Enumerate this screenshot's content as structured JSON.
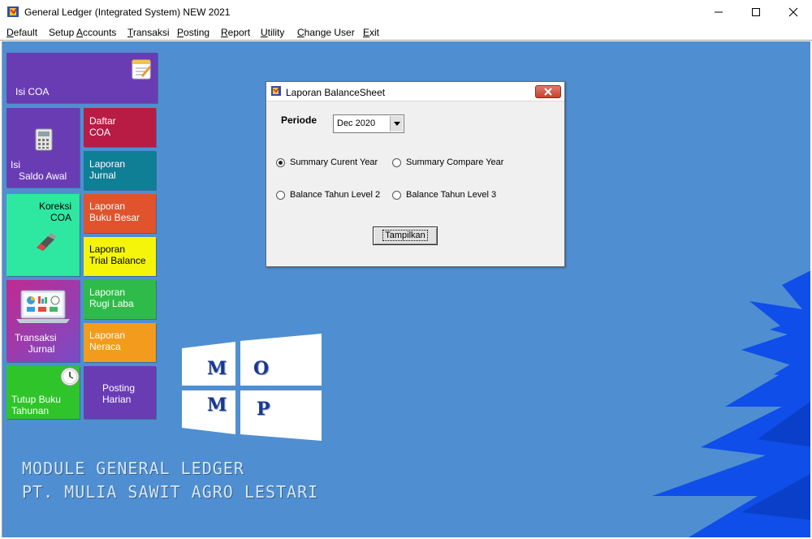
{
  "window": {
    "title": "General Ledger (Integrated System) NEW 2021",
    "app_icon": "app-icon",
    "buttons": [
      "minimize-icon",
      "maximize-icon",
      "close-icon"
    ]
  },
  "menu": {
    "items": [
      {
        "label": "Default",
        "u": "D",
        "rest": "efault"
      },
      {
        "label": "Setup Accounts",
        "pre": "Setup ",
        "u": "A",
        "rest": "ccounts"
      },
      {
        "label": "Transaksi",
        "u": "T",
        "rest": "ransaksi"
      },
      {
        "label": "Posting",
        "u": "P",
        "rest": "osting"
      },
      {
        "label": "Report",
        "u": "R",
        "rest": "eport"
      },
      {
        "label": "Utility",
        "u": "U",
        "rest": "tility"
      },
      {
        "label": "Change User",
        "u": "C",
        "rest": "hange User"
      },
      {
        "label": "Exit",
        "u": "E",
        "rest": "xit"
      }
    ]
  },
  "tiles": {
    "isi_coa": "Isi COA",
    "isi_saldo_awal": "Isi\n   Saldo Awal",
    "daftar_coa": "Daftar\nCOA",
    "laporan_jurnal": "Laporan\nJurnal",
    "koreksi_coa": "Koreksi\nCOA",
    "laporan_buku_besar": "Laporan\nBuku Besar",
    "laporan_trial_balance": "Laporan\nTrial Balance",
    "transaksi_jurnal": "Transaksi\n     Jurnal",
    "laporan_rugi_laba": "Laporan\nRugi Laba",
    "laporan_neraca": "Laporan\nNeraca",
    "tutup_buku_tahunan": "Tutup Buku\nTahunan",
    "posting_harian": "Posting\nHarian"
  },
  "colors": {
    "desktop": "#4f8fd1",
    "purple": "#6a3cb4",
    "crimson": "#b81c44",
    "teal": "#0e7f95",
    "mint": "#2ee8a2",
    "orange_red": "#e0532c",
    "yellow": "#f5f50a",
    "magenta": "#b5338f",
    "green": "#2fbb49",
    "orange": "#f39b1c",
    "bright_green": "#2fc42a"
  },
  "logo": {
    "letters": [
      "M",
      "O",
      "M",
      "P"
    ]
  },
  "footer": {
    "line1": "MODULE GENERAL LEDGER",
    "line2": "PT. MULIA SAWIT AGRO LESTARI"
  },
  "dialog": {
    "title": "Laporan BalanceSheet",
    "periode_label": "Periode",
    "periode_value": "Dec 2020",
    "options": [
      {
        "label": "Summary Curent Year",
        "selected": true
      },
      {
        "label": "Summary Compare Year",
        "selected": false
      },
      {
        "label": "Balance Tahun Level 2",
        "selected": false
      },
      {
        "label": "Balance Tahun Level 3",
        "selected": false
      }
    ],
    "button_label": "Tampilkan"
  }
}
